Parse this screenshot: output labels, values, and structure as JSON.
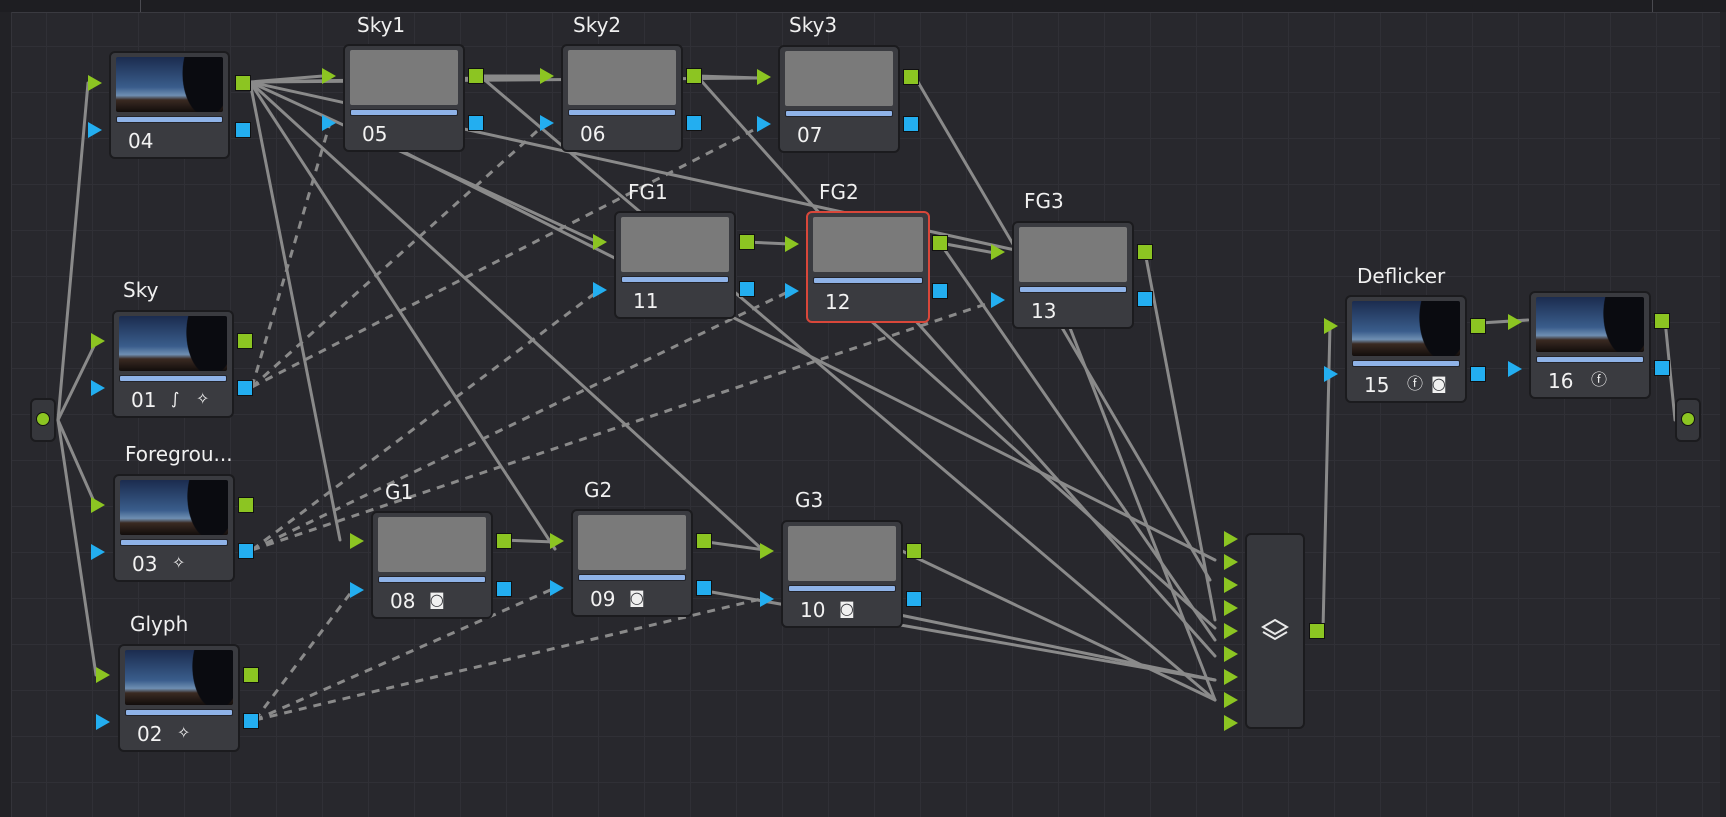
{
  "app": "DaVinci Resolve Color Page",
  "panel": "Node Editor",
  "colors": {
    "rgb_port": "#8cc522",
    "key_port": "#23aef0",
    "selected_border": "#d9473a",
    "link": "#8a8a8a"
  },
  "nodes": {
    "n04": {
      "label": "",
      "number": "04",
      "thumb": "photo",
      "icons": []
    },
    "n05": {
      "label": "Sky1",
      "number": "05",
      "thumb": "gray",
      "icons": []
    },
    "n06": {
      "label": "Sky2",
      "number": "06",
      "thumb": "gray",
      "icons": []
    },
    "n07": {
      "label": "Sky3",
      "number": "07",
      "thumb": "gray",
      "icons": []
    },
    "n01": {
      "label": "Sky",
      "number": "01",
      "thumb": "photo",
      "icons": [
        "curves-icon",
        "magic-wand-icon"
      ]
    },
    "n03": {
      "label": "Foregrou...",
      "number": "03",
      "thumb": "photo",
      "icons": [
        "magic-wand-icon"
      ]
    },
    "n02": {
      "label": "Glyph",
      "number": "02",
      "thumb": "photo",
      "icons": [
        "magic-wand-icon"
      ]
    },
    "n11": {
      "label": "FG1",
      "number": "11",
      "thumb": "gray",
      "icons": []
    },
    "n12": {
      "label": "FG2",
      "number": "12",
      "thumb": "gray",
      "icons": [],
      "selected": true
    },
    "n13": {
      "label": "FG3",
      "number": "13",
      "thumb": "gray",
      "icons": []
    },
    "n08": {
      "label": "G1",
      "number": "08",
      "thumb": "gray",
      "icons": [
        "mask-icon"
      ]
    },
    "n09": {
      "label": "G2",
      "number": "09",
      "thumb": "gray",
      "icons": [
        "mask-icon"
      ]
    },
    "n10": {
      "label": "G3",
      "number": "10",
      "thumb": "gray",
      "icons": [
        "mask-icon"
      ]
    },
    "n15": {
      "label": "Deflicker",
      "number": "15",
      "thumb": "photo",
      "icons": [
        "fx-icon",
        "mask-icon"
      ]
    },
    "n16": {
      "label": "",
      "number": "16",
      "thumb": "photo",
      "icons": [
        "fx-icon"
      ]
    }
  },
  "layer_mixer": {
    "icon": "layers-icon",
    "inputs": 9
  }
}
